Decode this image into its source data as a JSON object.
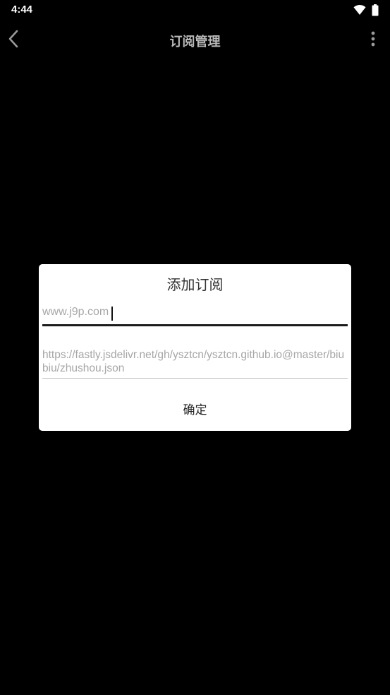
{
  "status_bar": {
    "time": "4:44"
  },
  "app_bar": {
    "title": "订阅管理"
  },
  "dialog": {
    "title": "添加订阅",
    "name_field": {
      "placeholder": "www.j9p.com",
      "value": ""
    },
    "url_field": {
      "placeholder": "https://fastly.jsdelivr.net/gh/ysztcn/ysztcn.github.io@master/biubiu/zhushou.json",
      "value": ""
    },
    "confirm_label": "确定"
  },
  "colors": {
    "background": "#000000",
    "title_text": "#b9b9b9",
    "dialog_bg": "#ffffff",
    "placeholder": "#a6a6a6"
  },
  "icons": {
    "back": "chevron-left-icon",
    "more": "more-vertical-icon",
    "wifi": "wifi-icon",
    "battery": "battery-icon"
  }
}
